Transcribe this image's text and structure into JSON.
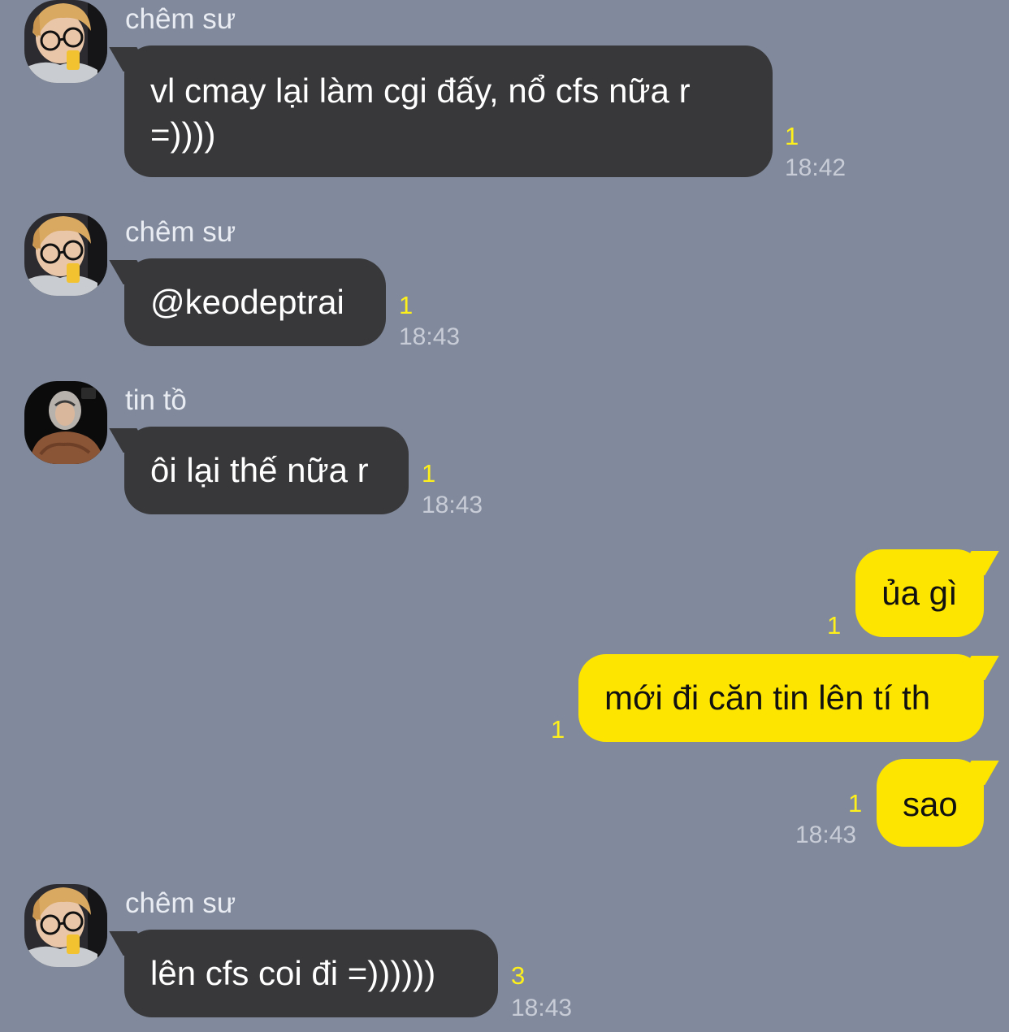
{
  "conversation": [
    {
      "sender": "chêm sư",
      "avatar": "chem-su-avatar",
      "text": "vl cmay lại làm cgi đấy, nổ cfs nữa r =))))",
      "unread": "1",
      "time": "18:42"
    },
    {
      "sender": "chêm sư",
      "avatar": "chem-su-avatar",
      "text": "@keodeptrai",
      "unread": "1",
      "time": "18:43"
    },
    {
      "sender": "tin tồ",
      "avatar": "tin-to-avatar",
      "text": "ôi lại thế nữa r",
      "unread": "1",
      "time": "18:43"
    },
    {
      "sender": "me",
      "text": "ủa gì",
      "unread": "1",
      "time": ""
    },
    {
      "sender": "me",
      "text": "mới đi căn tin lên tí th",
      "unread": "1",
      "time": ""
    },
    {
      "sender": "me",
      "text": "sao",
      "unread": "1",
      "time": "18:43"
    },
    {
      "sender": "chêm sư",
      "avatar": "chem-su-avatar",
      "text": "lên cfs coi đi =))))))",
      "unread": "3",
      "time": "18:43"
    }
  ],
  "colors": {
    "background": "#808a9c",
    "incoming_bubble": "#38383a",
    "outgoing_bubble": "#fee500",
    "unread_count": "#fef01b",
    "timestamp": "#c8ccd6"
  }
}
